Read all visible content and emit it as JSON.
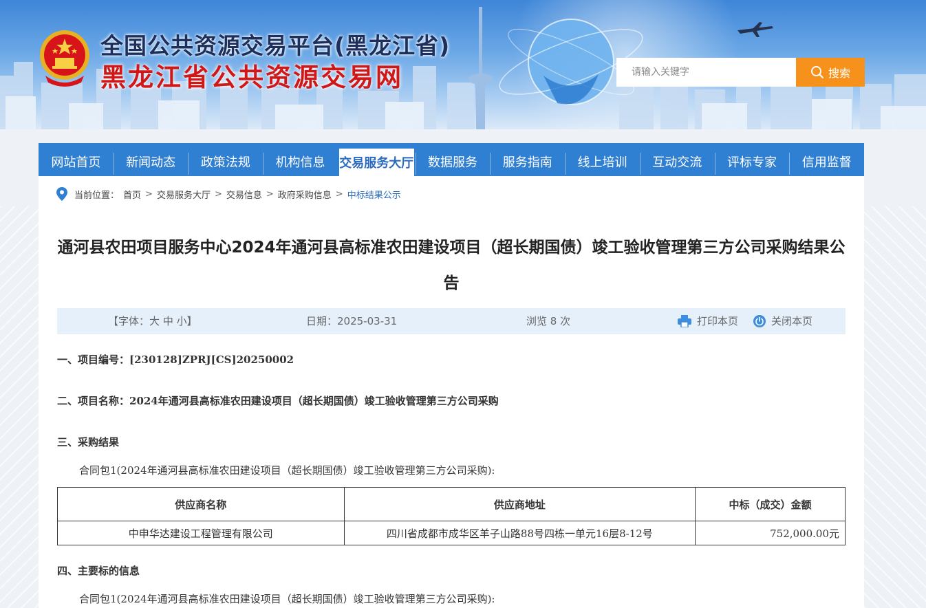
{
  "header": {
    "title_line1": "全国公共资源交易平台(黑龙江省)",
    "title_line2": "黑龙江省公共资源交易网",
    "search_placeholder": "请输入关键字",
    "search_button": "搜索"
  },
  "nav": {
    "items": [
      {
        "label": "网站首页"
      },
      {
        "label": "新闻动态"
      },
      {
        "label": "政策法规"
      },
      {
        "label": "机构信息"
      },
      {
        "label": "交易服务大厅",
        "active": true
      },
      {
        "label": "数据服务"
      },
      {
        "label": "服务指南"
      },
      {
        "label": "线上培训"
      },
      {
        "label": "互动交流"
      },
      {
        "label": "评标专家"
      },
      {
        "label": "信用监督"
      }
    ]
  },
  "breadcrumb": {
    "prefix": "当前位置：",
    "items": [
      "首页",
      "交易服务大厅",
      "交易信息",
      "政府采购信息"
    ],
    "current": "中标结果公示"
  },
  "article": {
    "title": "通河县农田项目服务中心2024年通河县高标准农田建设项目（超长期国债）竣工验收管理第三方公司采购结果公告",
    "meta": {
      "font_prefix": "【字体：",
      "font_large": "大",
      "font_medium": "中",
      "font_small": "小",
      "font_suffix": "】",
      "date": "日期：2025-03-31",
      "views": "浏览 8 次",
      "print": "打印本页",
      "close": "关闭本页"
    },
    "sections": {
      "s1": "一、项目编号：[230128]ZPRJ[CS]20250002",
      "s2": "二、项目名称：2024年通河县高标准农田建设项目（超长期国债）竣工验收管理第三方公司采购",
      "s3": "三、采购结果",
      "s3_para": "合同包1(2024年通河县高标准农田建设项目（超长期国债）竣工验收管理第三方公司采购):",
      "s4": "四、主要标的信息",
      "s4_para": "合同包1(2024年通河县高标准农田建设项目（超长期国债）竣工验收管理第三方公司采购):"
    },
    "result_table": {
      "headers": [
        "供应商名称",
        "供应商地址",
        "中标（成交）金额"
      ],
      "rows": [
        [
          "中申华达建设工程管理有限公司",
          "四川省成都市成华区羊子山路88号四栋一单元16层8-12号",
          "752,000.00元"
        ]
      ]
    }
  },
  "colors": {
    "nav_bg": "#2f7fd2",
    "search_button_bg": "#f6911b",
    "title_red": "#d11818",
    "link_blue": "#2a6bc0",
    "meta_bar_bg": "#e6f0fa"
  }
}
